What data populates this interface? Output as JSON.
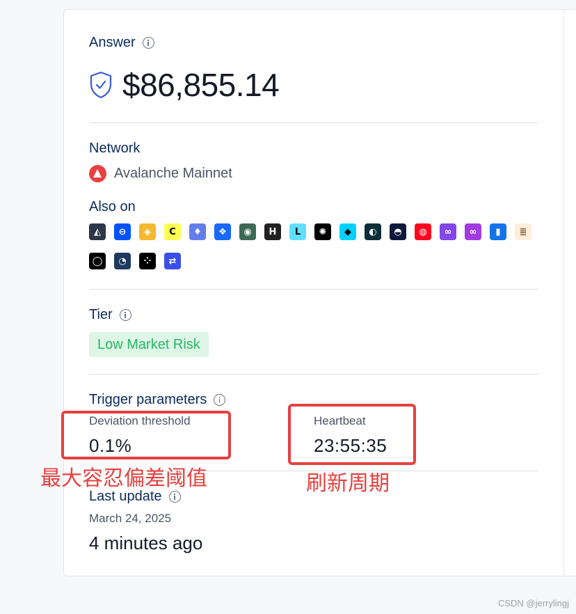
{
  "answer": {
    "label": "Answer",
    "value": "$86,855.14"
  },
  "network": {
    "label": "Network",
    "name": "Avalanche Mainnet"
  },
  "also_on": {
    "label": "Also on",
    "chains": [
      {
        "name": "arbitrum-icon",
        "bg": "#2d374b",
        "glyph": "◭"
      },
      {
        "name": "base-icon",
        "bg": "#0052ff",
        "glyph": "⊖"
      },
      {
        "name": "bnb-chain-icon",
        "bg": "#f3ba2f",
        "glyph": "◈"
      },
      {
        "name": "celo-icon",
        "bg": "#fcff52",
        "glyph": "C",
        "fg": "#000000"
      },
      {
        "name": "ethereum-icon",
        "bg": "#627eea",
        "glyph": "♦"
      },
      {
        "name": "fantom-icon",
        "bg": "#1969ff",
        "glyph": "❖"
      },
      {
        "name": "gnosis-icon",
        "bg": "#3e6957",
        "glyph": "◉"
      },
      {
        "name": "hedera-icon",
        "bg": "#222222",
        "glyph": "H"
      },
      {
        "name": "linea-icon",
        "bg": "#61dfff",
        "glyph": "L",
        "fg": "#000000"
      },
      {
        "name": "mantle-icon",
        "bg": "#000000",
        "glyph": "✺"
      },
      {
        "name": "metis-icon",
        "bg": "#00d2ff",
        "glyph": "◆",
        "fg": "#000000"
      },
      {
        "name": "moonbeam-icon",
        "bg": "#0b2e3a",
        "glyph": "◐"
      },
      {
        "name": "moonriver-icon",
        "bg": "#0e1a3a",
        "glyph": "◓"
      },
      {
        "name": "optimism-icon",
        "bg": "#ff0420",
        "glyph": "◍"
      },
      {
        "name": "polygon-icon",
        "bg": "#8247e5",
        "glyph": "∞"
      },
      {
        "name": "polygon-zkevm-icon",
        "bg": "#a13ce0",
        "glyph": "∞"
      },
      {
        "name": "ronin-icon",
        "bg": "#1273ea",
        "glyph": "▮"
      },
      {
        "name": "scroll-icon",
        "bg": "#ffeeda",
        "glyph": "≣",
        "fg": "#7a5a3a"
      },
      {
        "name": "soneium-icon",
        "bg": "#000000",
        "glyph": "◯"
      },
      {
        "name": "sonic-icon",
        "bg": "#1f3a5f",
        "glyph": "◔"
      },
      {
        "name": "starknet-icon",
        "bg": "#000000",
        "glyph": "⁘"
      },
      {
        "name": "zksync-icon",
        "bg": "#3b4ee8",
        "glyph": "⇄"
      }
    ]
  },
  "tier": {
    "label": "Tier",
    "badge": "Low Market Risk"
  },
  "trigger": {
    "label": "Trigger parameters",
    "deviation_label": "Deviation threshold",
    "deviation_value": "0.1%",
    "heartbeat_label": "Heartbeat",
    "heartbeat_value": "23:55:35"
  },
  "annotations": {
    "deviation_note": "最大容忍偏差阈值",
    "heartbeat_note": "刷新周期"
  },
  "last_update": {
    "label": "Last update",
    "date": "March 24, 2025",
    "relative": "4 minutes ago"
  },
  "watermark": "CSDN @jerrylingj",
  "colors": {
    "label": "#0b2a5c",
    "annotation_red": "#e5413f",
    "badge_bg": "#ddf6e6",
    "badge_text": "#2bb563",
    "avalanche": "#e84142"
  }
}
